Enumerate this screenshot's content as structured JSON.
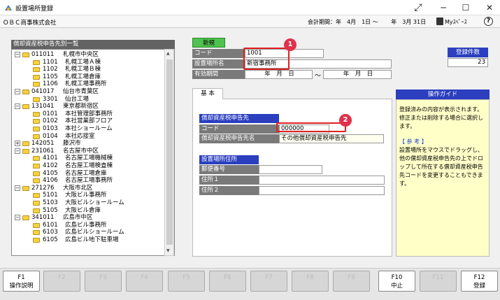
{
  "window": {
    "title": "設置場所登録"
  },
  "menubar": {
    "company": "ＯＢＣ商事株式会社",
    "period_label": "会計期間：",
    "period_value": "年　4月　1日 ～ 　　年　3月 31日",
    "myspace": "Myｽﾍﾟｰｽ"
  },
  "tree": {
    "header": "償却資産税申告先別一覧",
    "rows": [
      {
        "level": 0,
        "code": "011011",
        "name": "札幌市中央区",
        "expanded": true
      },
      {
        "level": 1,
        "code": "1101",
        "name": "札幌工場Ａ棟"
      },
      {
        "level": 1,
        "code": "1102",
        "name": "札幌工場Ｂ棟"
      },
      {
        "level": 1,
        "code": "1105",
        "name": "札幌工場倉庫"
      },
      {
        "level": 1,
        "code": "1106",
        "name": "札幌工場事務所"
      },
      {
        "level": 0,
        "code": "041017",
        "name": "仙台市青葉区",
        "expanded": true
      },
      {
        "level": 1,
        "code": "3301",
        "name": "仙台工場"
      },
      {
        "level": 0,
        "code": "131041",
        "name": "東京都新宿区",
        "expanded": true
      },
      {
        "level": 1,
        "code": "0101",
        "name": "本社管理部事務所"
      },
      {
        "level": 1,
        "code": "0102",
        "name": "本社営業部フロア"
      },
      {
        "level": 1,
        "code": "0103",
        "name": "本社ショールーム"
      },
      {
        "level": 1,
        "code": "0104",
        "name": "本社応接室"
      },
      {
        "level": 0,
        "code": "142051",
        "name": "藤沢市",
        "expanded": false
      },
      {
        "level": 0,
        "code": "231061",
        "name": "名古屋市中区",
        "expanded": true
      },
      {
        "level": 1,
        "code": "4101",
        "name": "名古屋工場機械棟"
      },
      {
        "level": 1,
        "code": "4102",
        "name": "名古屋工場検査棟"
      },
      {
        "level": 1,
        "code": "4105",
        "name": "名古屋工場倉庫"
      },
      {
        "level": 1,
        "code": "4106",
        "name": "名古屋工場事務所"
      },
      {
        "level": 0,
        "code": "271276",
        "name": "大阪市北区",
        "expanded": true
      },
      {
        "level": 1,
        "code": "5101",
        "name": "大阪ビル事務所"
      },
      {
        "level": 1,
        "code": "5103",
        "name": "大阪ビルショールーム"
      },
      {
        "level": 1,
        "code": "5105",
        "name": "大阪ビル倉庫"
      },
      {
        "level": 0,
        "code": "341011",
        "name": "広島市中区",
        "expanded": true
      },
      {
        "level": 1,
        "code": "6101",
        "name": "広島ビル事務所"
      },
      {
        "level": 1,
        "code": "6103",
        "name": "広島ビルショールーム"
      },
      {
        "level": 1,
        "code": "6105",
        "name": "広島ビル地下駐車場"
      }
    ]
  },
  "form": {
    "new_label": "新規",
    "code_label": "コード",
    "code_value": "1001",
    "name_label": "設置場所名",
    "name_value": "新宿事務所",
    "valid_label": "有効期間",
    "valid_from": "年　月　日",
    "valid_tilde": "～",
    "valid_to": "年　月　日",
    "count_label": "登録件数",
    "count_value": "23"
  },
  "tab": {
    "basic": "基 本"
  },
  "tax_section": {
    "header": "償却資産税申告先",
    "code_label": "コード",
    "code_value": "000000",
    "name_label": "償却資産税申告先名",
    "name_value": "その他償却資産税申告先"
  },
  "address_section": {
    "header": "設置場所住所",
    "postal_label": "郵便番号",
    "addr1_label": "住所１",
    "addr2_label": "住所２"
  },
  "guide": {
    "header": "操作ガイド",
    "para1": "登録済みの内容が表示されます。",
    "para2": "修正または削除する場合に選択します。",
    "ref_title": "【 参 考 】",
    "para3": "設置場所をマウスでドラッグし、他の償却資産税申告先の上でドロップして所在する償却資産税申告先コードを変更することもできます。"
  },
  "annotations": {
    "one": "1",
    "two": "2"
  },
  "fkeys": [
    {
      "key": "F1",
      "label": "操作説明",
      "enabled": true
    },
    {
      "key": "F2",
      "label": "",
      "enabled": false
    },
    {
      "key": "F3",
      "label": "",
      "enabled": false
    },
    {
      "key": "F4",
      "label": "",
      "enabled": false
    },
    {
      "key": "F5",
      "label": "",
      "enabled": false
    },
    {
      "key": "F6",
      "label": "",
      "enabled": false
    },
    {
      "key": "F7",
      "label": "",
      "enabled": false
    },
    {
      "key": "F8",
      "label": "",
      "enabled": false
    },
    {
      "key": "F9",
      "label": "",
      "enabled": false
    },
    {
      "key": "F10",
      "label": "中止",
      "enabled": true
    },
    {
      "key": "F11",
      "label": "",
      "enabled": false
    },
    {
      "key": "F12",
      "label": "登録",
      "enabled": true
    }
  ]
}
